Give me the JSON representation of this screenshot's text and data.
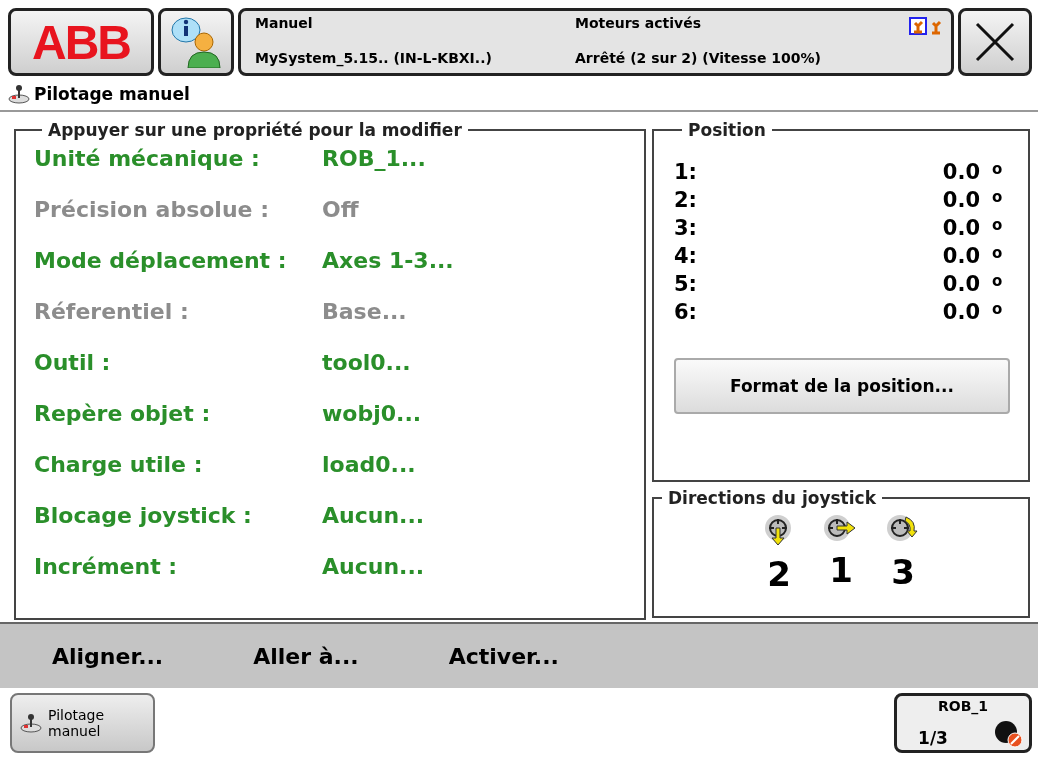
{
  "header": {
    "logo": "ABB",
    "status": {
      "mode": "Manuel",
      "system": "MySystem_5.15.. (IN-L-KBXI..)",
      "motors": "Moteurs activés",
      "state": "Arrêté (2 sur 2) (Vitesse 100%)"
    }
  },
  "view_title": "Pilotage manuel",
  "properties": {
    "legend": "Appuyer sur une propriété pour la modifier",
    "items": [
      {
        "label": "Unité mécanique :",
        "value": "ROB_1...",
        "disabled": false
      },
      {
        "label": "Précision absolue :",
        "value": "Off",
        "disabled": true
      },
      {
        "label": "Mode déplacement :",
        "value": "Axes 1-3...",
        "disabled": false
      },
      {
        "label": "Réferentiel :",
        "value": "Base...",
        "disabled": true
      },
      {
        "label": "Outil :",
        "value": "tool0...",
        "disabled": false
      },
      {
        "label": "Repère objet :",
        "value": "wobj0...",
        "disabled": false
      },
      {
        "label": "Charge utile :",
        "value": "load0...",
        "disabled": false
      },
      {
        "label": "Blocage joystick :",
        "value": "Aucun...",
        "disabled": false
      },
      {
        "label": "Incrément :",
        "value": "Aucun...",
        "disabled": false
      }
    ]
  },
  "position": {
    "legend": "Position",
    "rows": [
      {
        "axis": "1:",
        "value": "0.0",
        "unit": "o"
      },
      {
        "axis": "2:",
        "value": "0.0",
        "unit": "o"
      },
      {
        "axis": "3:",
        "value": "0.0",
        "unit": "o"
      },
      {
        "axis": "4:",
        "value": "0.0",
        "unit": "o"
      },
      {
        "axis": "5:",
        "value": "0.0",
        "unit": "o"
      },
      {
        "axis": "6:",
        "value": "0.0",
        "unit": "o"
      }
    ],
    "format_button": "Format de la position..."
  },
  "joystick": {
    "legend": "Directions du joystick",
    "directions": [
      {
        "kind": "down",
        "label": "2"
      },
      {
        "kind": "right",
        "label": "1"
      },
      {
        "kind": "rotate",
        "label": "3"
      }
    ]
  },
  "commands": [
    "Aligner...",
    "Aller à...",
    "Activer..."
  ],
  "taskbar": {
    "app": [
      "Pilotage",
      "manuel"
    ],
    "unit": "ROB_1",
    "unit_fraction": "1/3"
  }
}
